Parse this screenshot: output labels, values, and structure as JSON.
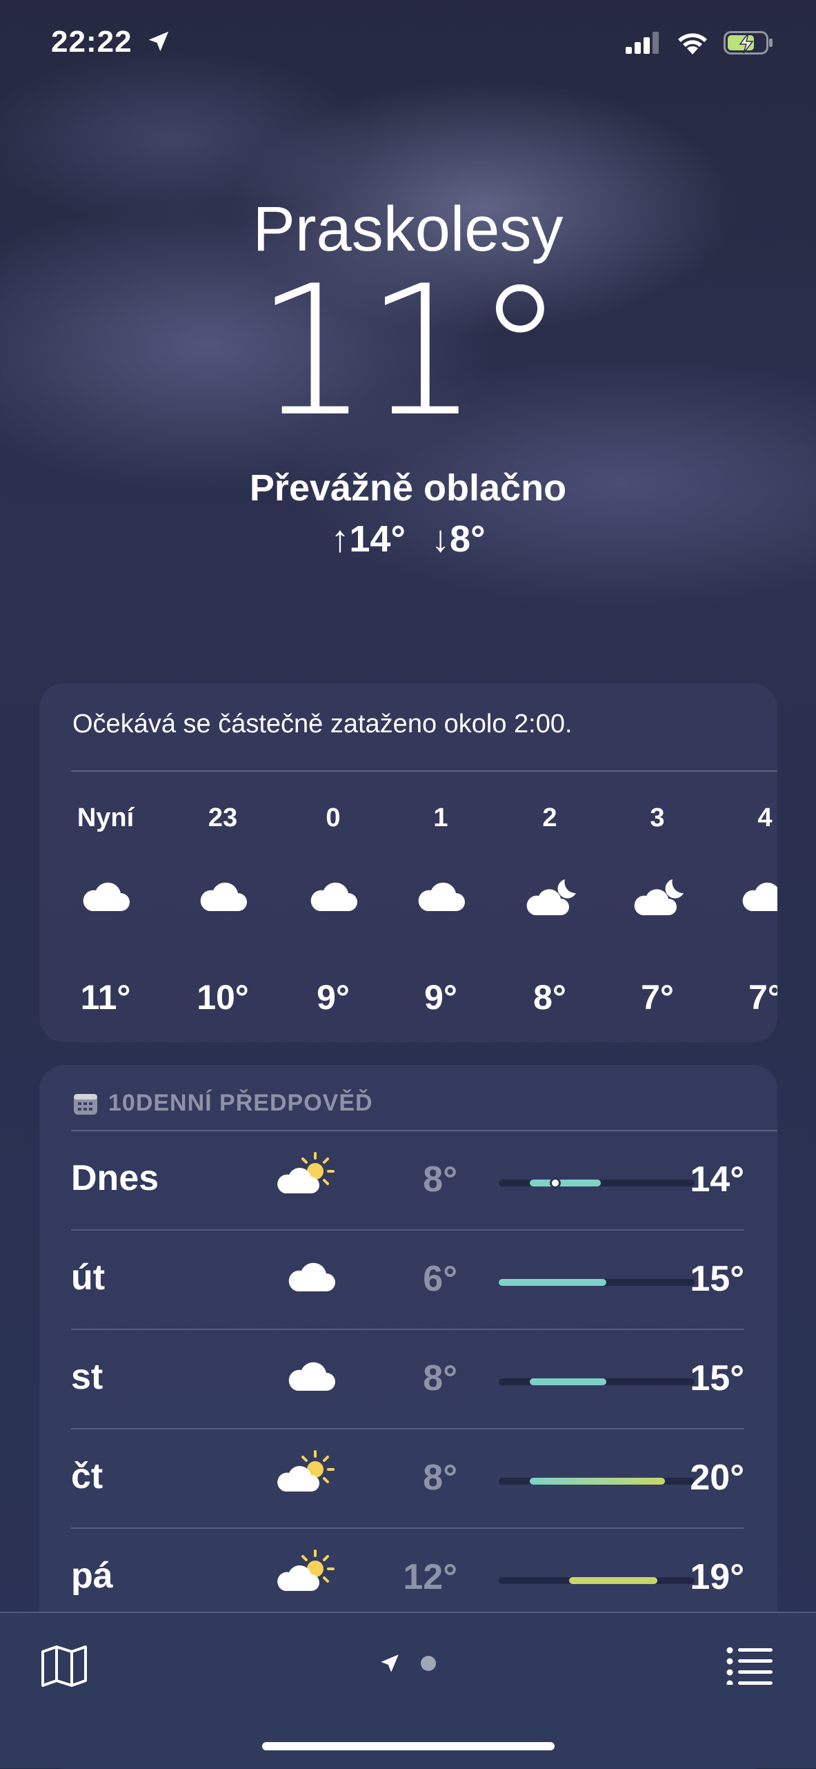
{
  "status": {
    "time": "22:22",
    "icons": [
      "location-arrow-icon",
      "signal-icon",
      "wifi-icon",
      "battery-charging-icon"
    ]
  },
  "header": {
    "city": "Praskolesy",
    "temperature": "11°",
    "condition": "Převážně oblačno",
    "high_low": "↑14° ↓8°"
  },
  "hourly": {
    "summary": "Očekává se částečně zataženo okolo 2:00.",
    "items": [
      {
        "label": "Nyní",
        "icon": "cloud-icon",
        "temp": "11°"
      },
      {
        "label": "23",
        "icon": "cloud-icon",
        "temp": "10°"
      },
      {
        "label": "0",
        "icon": "cloud-icon",
        "temp": "9°"
      },
      {
        "label": "1",
        "icon": "cloud-icon",
        "temp": "9°"
      },
      {
        "label": "2",
        "icon": "cloud-moon-icon",
        "temp": "8°"
      },
      {
        "label": "3",
        "icon": "cloud-moon-icon",
        "temp": "7°"
      },
      {
        "label": "4",
        "icon": "cloud-icon",
        "temp": "7°"
      }
    ]
  },
  "daily": {
    "title": "10DENNÍ PŘEDPOVĚĎ",
    "days": [
      {
        "name": "Dnes",
        "icon": "partly-sunny-icon",
        "low": "8°",
        "high": "14°",
        "range_start": 0.16,
        "range_end": 0.52,
        "current": 0.29
      },
      {
        "name": "út",
        "icon": "cloud-icon",
        "low": "6°",
        "high": "15°",
        "range_start": 0.0,
        "range_end": 0.55
      },
      {
        "name": "st",
        "icon": "cloud-icon",
        "low": "8°",
        "high": "15°",
        "range_start": 0.16,
        "range_end": 0.55
      },
      {
        "name": "čt",
        "icon": "partly-sunny-icon",
        "low": "8°",
        "high": "20°",
        "range_start": 0.16,
        "range_end": 0.85
      },
      {
        "name": "pá",
        "icon": "partly-sunny-icon",
        "low": "12°",
        "high": "19°",
        "range_start": 0.36,
        "range_end": 0.81
      }
    ],
    "colors": {
      "cool": "#7fd1c8",
      "warm": "#c6d66a"
    }
  },
  "bottom": {
    "map_icon": "map-icon",
    "location_icon": "location-arrow-icon",
    "list_icon": "list-icon"
  }
}
